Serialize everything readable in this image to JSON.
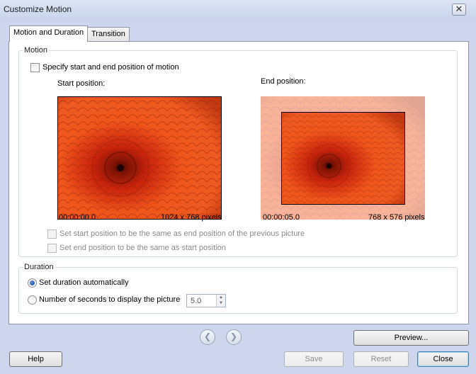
{
  "window": {
    "title": "Customize Motion",
    "close_glyph": "✕"
  },
  "tabs": [
    {
      "label": "Motion and Duration",
      "active": true
    },
    {
      "label": "Transition",
      "active": false
    }
  ],
  "motion": {
    "group_label": "Motion",
    "specify_checkbox": {
      "label": "Specify start and end position of motion",
      "checked": false
    },
    "start": {
      "label": "Start position:",
      "time": "00:00:00.0",
      "size": "1024 x 768 pixels"
    },
    "end": {
      "label": "End position:",
      "time": "00:00:05.0",
      "size": "768 x 576 pixels"
    },
    "same_as_prev": {
      "label": "Set start position to be the same as end position of the previous picture",
      "checked": false,
      "enabled": false
    },
    "end_same_as_start": {
      "label": "Set end position to be the same as start position",
      "checked": false,
      "enabled": false
    }
  },
  "duration": {
    "group_label": "Duration",
    "auto": {
      "label": "Set duration automatically",
      "selected": true
    },
    "seconds": {
      "label": "Number of seconds to display the picture",
      "selected": false,
      "value": "5.0"
    }
  },
  "nav": {
    "prev_glyph": "❮",
    "next_glyph": "❯"
  },
  "buttons": {
    "preview": "Preview...",
    "help": "Help",
    "save": "Save",
    "reset": "Reset",
    "close": "Close"
  },
  "colors": {
    "flower_outer": "#f0561c",
    "flower_mid": "#c8230c",
    "flower_center": "#3a0500"
  }
}
